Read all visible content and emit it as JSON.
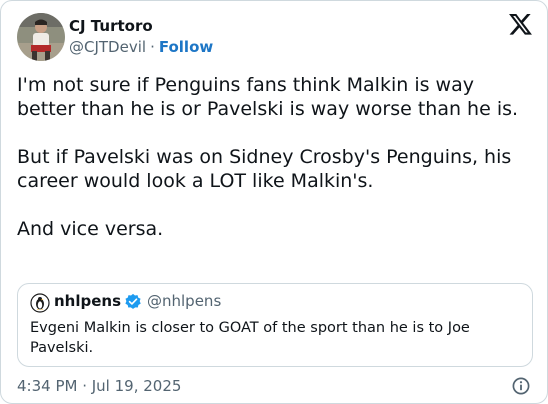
{
  "author": {
    "name": "CJ Turtoro",
    "handle": "@CJTDevil",
    "separator": "·",
    "follow_label": "Follow"
  },
  "brand_icon": "x-logo-icon",
  "tweet": {
    "paragraphs": [
      "I'm not sure if Penguins fans think Malkin is way better than he is or Pavelski is way worse than he is.",
      "But if Pavelski was on Sidney Crosby's Penguins, his career would look a LOT like Malkin's.",
      "And vice versa."
    ]
  },
  "quote": {
    "name": "nhlpens",
    "handle": "@nhlpens",
    "verified_icon": "verified-badge-icon",
    "text": "Evgeni Malkin is closer to GOAT of the sport than he is to Joe Pavelski."
  },
  "footer": {
    "timestamp": "4:34 PM · Jul 19, 2025",
    "info_icon": "info-icon"
  },
  "colors": {
    "text": "#0f1419",
    "secondary": "#536471",
    "link": "#1d76c6",
    "border": "#cfd9de",
    "verified": "#1d9bf0"
  }
}
